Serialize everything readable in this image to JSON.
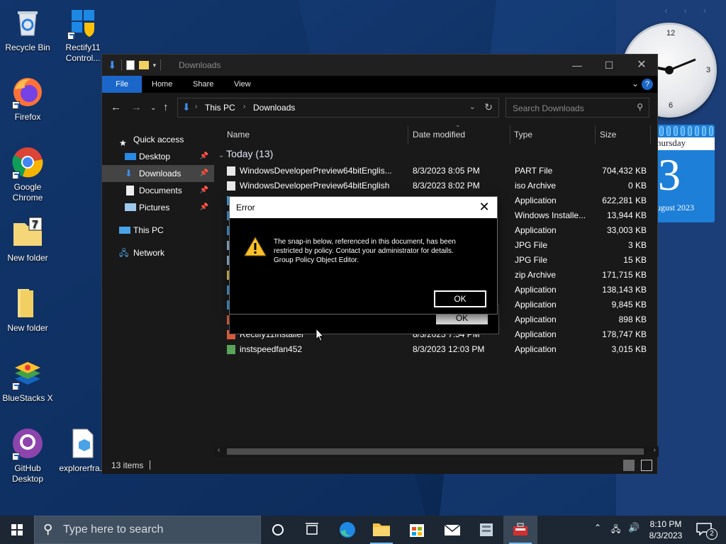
{
  "desktop": {
    "icons": [
      {
        "label": "Recycle Bin"
      },
      {
        "label": "Rectify11 Control..."
      },
      {
        "label": "Firefox"
      },
      {
        "label": "Google Chrome"
      },
      {
        "label": "New folder"
      },
      {
        "label": "New folder"
      },
      {
        "label": "BlueStacks X"
      },
      {
        "label": "GitHub Desktop"
      },
      {
        "label": "explorerfra..."
      }
    ]
  },
  "gadgets": {
    "clock_numbers": [
      "12",
      "3",
      "6"
    ],
    "calendar": {
      "weekday": "hursday",
      "day": "3",
      "month": "ugust 2023"
    }
  },
  "explorer": {
    "title": "Downloads",
    "tabs": [
      "File",
      "Home",
      "Share",
      "View"
    ],
    "breadcrumb": [
      "This PC",
      "Downloads"
    ],
    "search_placeholder": "Search Downloads",
    "nav": {
      "quick_access": "Quick access",
      "items": [
        "Desktop",
        "Downloads",
        "Documents",
        "Pictures"
      ],
      "this_pc": "This PC",
      "network": "Network"
    },
    "columns": [
      "Name",
      "Date modified",
      "Type",
      "Size"
    ],
    "group": "Today (13)",
    "rows": [
      {
        "name": "WindowsDeveloperPreview64bitEnglis...",
        "date": "8/3/2023 8:05 PM",
        "type": "PART File",
        "size": "704,432 KB"
      },
      {
        "name": "WindowsDeveloperPreview64bitEnglish",
        "date": "8/3/2023 8:02 PM",
        "type": "iso Archive",
        "size": "0 KB"
      },
      {
        "name": "",
        "date": "",
        "type": "Application",
        "size": "622,281 KB"
      },
      {
        "name": "",
        "date": "",
        "type": "Windows Installe...",
        "size": "13,944 KB"
      },
      {
        "name": "",
        "date": "",
        "type": "Application",
        "size": "33,003 KB"
      },
      {
        "name": "",
        "date": "",
        "type": "JPG File",
        "size": "3 KB"
      },
      {
        "name": "",
        "date": "",
        "type": "JPG File",
        "size": "15 KB"
      },
      {
        "name": "",
        "date": "",
        "type": "zip Archive",
        "size": "171,715 KB"
      },
      {
        "name": "",
        "date": "",
        "type": "Application",
        "size": "138,143 KB"
      },
      {
        "name": "",
        "date": "",
        "type": "Application",
        "size": "9,845 KB"
      },
      {
        "name": "",
        "date": "",
        "type": "Application",
        "size": "898 KB"
      },
      {
        "name": "Rectify11Installer",
        "date": "8/3/2023 7:54 PM",
        "type": "Application",
        "size": "178,747 KB"
      },
      {
        "name": "instspeedfan452",
        "date": "8/3/2023 12:03 PM",
        "type": "Application",
        "size": "3,015 KB"
      }
    ],
    "status": "13 items"
  },
  "error_dialog": {
    "title": "Error",
    "lines": [
      "The snap-in below, referenced in this document, has been",
      "restricted by policy. Contact your administrator for details.",
      "Group Policy Object Editor."
    ],
    "ok": "OK",
    "ghost_ok": "OK"
  },
  "taskbar": {
    "search_placeholder": "Type here to search",
    "time": "8:10 PM",
    "date": "8/3/2023",
    "notifications": "2"
  },
  "colors": {
    "accent": "#1a67c9",
    "window_bg": "#191919",
    "taskbar": "#1c2733"
  }
}
